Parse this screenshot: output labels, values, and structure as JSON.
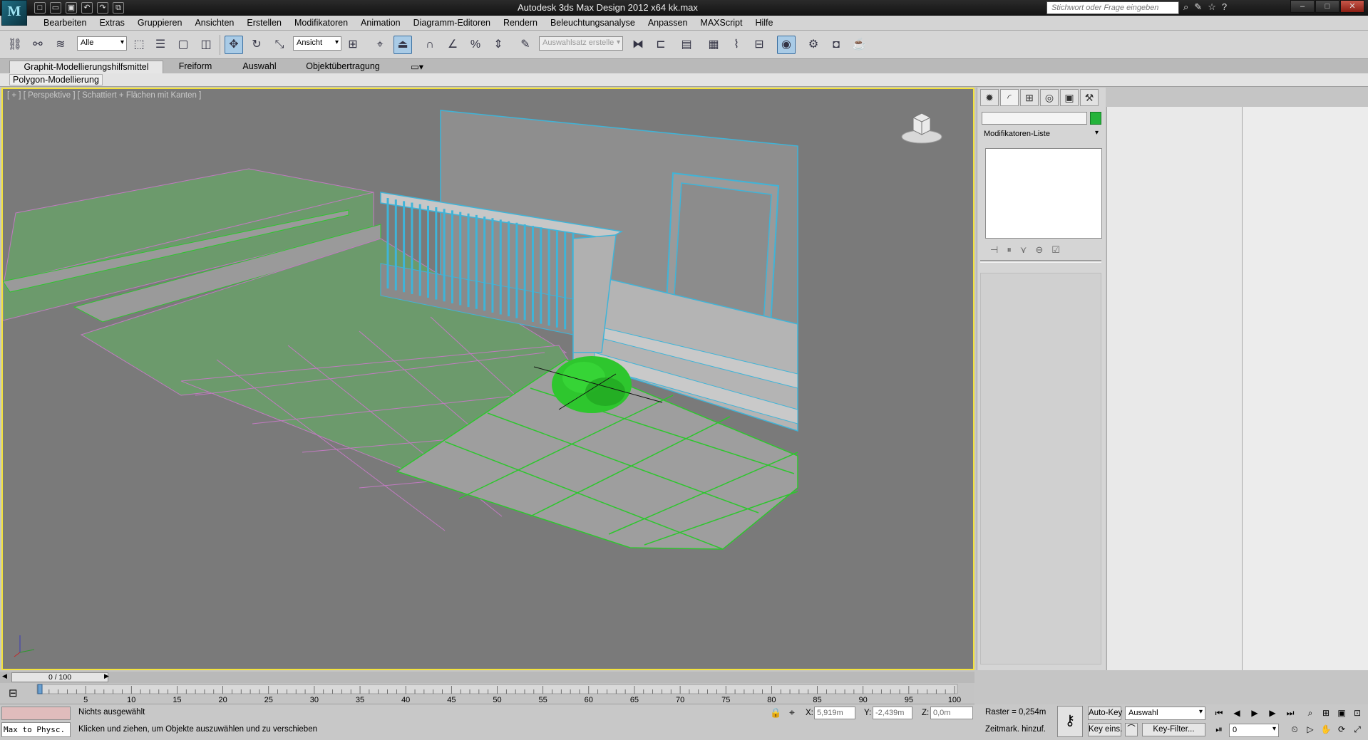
{
  "app": {
    "logo_text": "M",
    "title": "Autodesk 3ds Max Design 2012 x64      kk.max",
    "search_placeholder": "Stichwort oder Frage eingeben"
  },
  "menu": [
    "Bearbeiten",
    "Extras",
    "Gruppieren",
    "Ansichten",
    "Erstellen",
    "Modifikatoren",
    "Animation",
    "Diagramm-Editoren",
    "Rendern",
    "Beleuchtungsanalyse",
    "Anpassen",
    "MAXScript",
    "Hilfe"
  ],
  "toolbar": {
    "selection_filter": "Alle",
    "reference_coord": "Ansicht",
    "named_selection_placeholder": "Auswahlsatz erstelle"
  },
  "ribbon": {
    "tabs": [
      "Graphit-Modellierungshilfsmittel",
      "Freiform",
      "Auswahl",
      "Objektübertragung"
    ],
    "panel_label": "Polygon-Modellierung"
  },
  "viewport": {
    "label": "[ + ] [ Perspektive ] [ Schattiert + Flächen mit Kanten ]",
    "border_color": "#f3e23b",
    "accent_green": "#2ec62e",
    "selection_cyan": "#3fb4d8"
  },
  "command_panel": {
    "modifier_list": "Modifikatoren-Liste",
    "object_color": "#24b33a"
  },
  "timeline": {
    "frame_display": "0 / 100",
    "ticks": [
      "5",
      "10",
      "15",
      "20",
      "25",
      "30",
      "35",
      "40",
      "45",
      "50",
      "55",
      "60",
      "65",
      "70",
      "75",
      "80",
      "85",
      "90",
      "95",
      "100"
    ]
  },
  "status": {
    "script_listener": "Max to Physc.",
    "selection": "Nichts ausgewählt",
    "prompt": "Klicken und ziehen, um Objekte auszuwählen und zu verschieben",
    "x_label": "X:",
    "x_value": "5,919m",
    "y_label": "Y:",
    "y_value": "-2,439m",
    "z_label": "Z:",
    "z_value": "0,0m",
    "grid": "Raster = 0,254m",
    "add_time_tag": "Zeitmark. hinzuf."
  },
  "animation": {
    "auto_key": "Auto-Key",
    "set_key": "Key eins.",
    "key_mode": "Auswahl",
    "key_filters": "Key-Filter...",
    "current_frame": "0"
  }
}
